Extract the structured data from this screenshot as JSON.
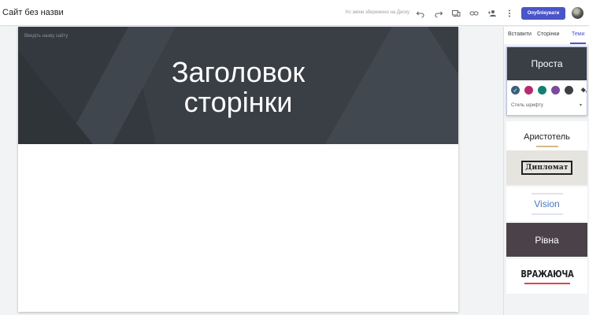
{
  "header": {
    "site_title": "Сайт без назви",
    "saved_status": "Усі зміни збережено на Диску",
    "publish_label": "Опублікувати",
    "icons": [
      "undo-icon",
      "redo-icon",
      "device-preview-icon",
      "link-icon",
      "share-person-icon",
      "more-vert-icon"
    ]
  },
  "page": {
    "site_name_placeholder": "Введіть назву сайту",
    "title_line1": "Заголовок",
    "title_line2": "сторінки"
  },
  "sidebar": {
    "tabs": [
      {
        "label": "Вставити"
      },
      {
        "label": "Сторінки"
      },
      {
        "label": "Теми"
      }
    ],
    "active_tab": "Теми",
    "themes": {
      "simple": {
        "name": "Проста",
        "font_style_label": "Стиль шрифту",
        "colors": [
          "#3a5f7d",
          "#b62b6e",
          "#13806e",
          "#7b4b9a",
          "#3c3f43"
        ]
      },
      "aristotel": {
        "name": "Аристотель"
      },
      "diplomat": {
        "name": "Дипломат"
      },
      "vision": {
        "name": "Vision"
      },
      "rivna": {
        "name": "Рівна"
      },
      "vrazh": {
        "name": "ВРАЖАЮЧА"
      }
    }
  },
  "colors": {
    "accent": "#4a55c8",
    "header_band": "#3a3f45"
  }
}
